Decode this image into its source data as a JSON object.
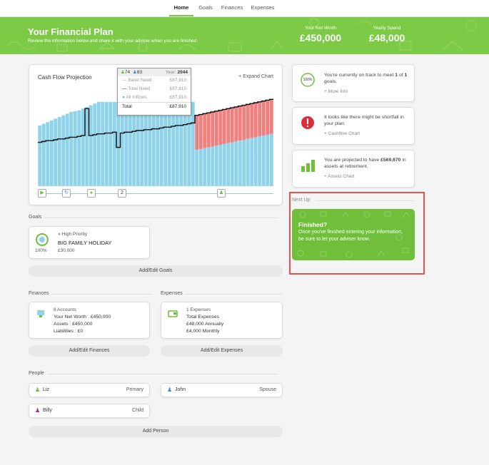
{
  "nav": {
    "tabs": [
      "Home",
      "Goals",
      "Finances",
      "Expenses"
    ],
    "active": "Home"
  },
  "banner": {
    "title": "Your Financial Plan",
    "subtitle": "Review the information below and share it with your adviser when you are finished.",
    "net_worth_label": "Your Net Worth",
    "net_worth_value": "£450,000",
    "yearly_spend_label": "Yearly Spend",
    "yearly_spend_value": "£48,000"
  },
  "chart": {
    "title": "Cash Flow Projection",
    "expand_label": "Expand Chart",
    "tooltip": {
      "count_a": "74",
      "count_b": "83",
      "year_label": "Year:",
      "year_value": "2044",
      "rows": [
        {
          "label": "Basic Need",
          "value": "£87,910"
        },
        {
          "label": "Total Need",
          "value": "£87,910"
        },
        {
          "label": "All Inflows",
          "value": "£87,910"
        }
      ],
      "total_label": "Total",
      "total_value": "£87,910"
    },
    "timeline_step": "2"
  },
  "chart_data": {
    "type": "bar",
    "note_series": [
      "inflows",
      "shortfall",
      "need_line"
    ],
    "inflows": [
      72,
      74,
      76,
      78,
      80,
      82,
      84,
      86,
      88,
      89,
      90,
      92,
      94,
      96,
      98,
      100,
      100,
      100,
      100,
      100,
      100,
      100,
      100,
      100,
      100,
      100,
      100,
      100,
      100,
      100,
      100,
      100,
      100,
      100,
      100,
      100,
      100,
      100,
      100,
      100,
      43,
      44,
      45,
      46,
      47,
      48,
      49,
      50,
      51,
      52,
      53,
      54,
      55,
      56,
      57,
      58,
      59,
      60,
      61,
      62
    ],
    "shortfall_top": [
      0,
      0,
      0,
      0,
      0,
      0,
      0,
      0,
      0,
      0,
      0,
      0,
      0,
      0,
      0,
      0,
      0,
      0,
      0,
      0,
      0,
      0,
      0,
      0,
      0,
      0,
      0,
      0,
      0,
      0,
      0,
      0,
      0,
      0,
      0,
      0,
      0,
      0,
      0,
      0,
      84,
      85,
      86,
      87,
      88,
      89,
      90,
      91,
      92,
      93,
      94,
      95,
      96,
      97,
      98,
      99,
      100,
      101,
      102,
      103
    ],
    "need_line": [
      52,
      53,
      54,
      54,
      55,
      56,
      56,
      57,
      58,
      58,
      59,
      60,
      92,
      60,
      61,
      62,
      62,
      63,
      63,
      64,
      46,
      63,
      64,
      64,
      65,
      66,
      66,
      67,
      67,
      68,
      68,
      69,
      70,
      70,
      71,
      72,
      72,
      73,
      74,
      75,
      84,
      85,
      86,
      87,
      88,
      89,
      90,
      91,
      92,
      93,
      94,
      95,
      96,
      97,
      98,
      99,
      100,
      101,
      102,
      103
    ]
  },
  "side": {
    "track": {
      "badge": "100%",
      "text_a": "You're currently on track to meet ",
      "goals_met": "1",
      "text_b": " of ",
      "goals_total": "1",
      "text_c": " goals.",
      "link": "More Info"
    },
    "shortfall": {
      "text": "It looks like there might be shortfall in your plan.",
      "link": "Cashflow Chart"
    },
    "assets": {
      "text_a": "You are projected to have ",
      "amount": "£569,670",
      "text_b": " in assets at retirement.",
      "link": "Assets Chart"
    }
  },
  "next_up": {
    "label": "Next Up",
    "title": "Finished?",
    "message": "Once you've finished entering your information, be sure to let your adviser know."
  },
  "goals": {
    "label": "Goals",
    "item": {
      "priority": "High Priority",
      "name": "BIG FAMILY HOLIDAY",
      "percent": "100%",
      "amount": "£30,000"
    },
    "button": "Add/Edit Goals"
  },
  "finances": {
    "label": "Finances",
    "accounts": "8 Accounts",
    "net_worth_label": "Your Net Worth :",
    "net_worth": "£450,000",
    "assets_label": "Assets :",
    "assets": "£450,000",
    "liabilities_label": "Liabilities :",
    "liabilities": "£0",
    "button": "Add/Edit Finances"
  },
  "expenses": {
    "label": "Expenses",
    "count": "1 Expenses",
    "total_label": "Total Expenses",
    "annual": "£48,000 Annually",
    "monthly": "£4,000 Monthly",
    "button": "Add/Edit Expenses"
  },
  "people": {
    "label": "People",
    "list": [
      {
        "name": "Liz",
        "role": "Primary"
      },
      {
        "name": "John",
        "role": "Spouse"
      },
      {
        "name": "Billy",
        "role": "Child"
      }
    ],
    "button": "Add Person"
  },
  "colors": {
    "green": "#7cca45",
    "blue": "#8fd3ea",
    "red": "#f08080",
    "line": "#111111"
  }
}
